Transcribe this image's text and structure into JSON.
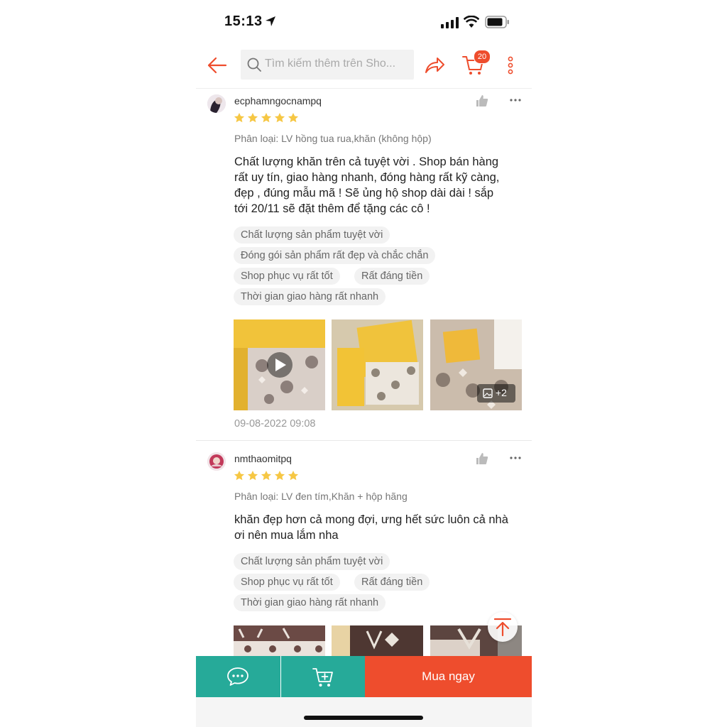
{
  "status": {
    "time": "15:13"
  },
  "header": {
    "search_placeholder": "Tìm kiếm thêm trên Sho...",
    "cart_count": "20"
  },
  "reviews": [
    {
      "username": "ecphamngocnampq",
      "rating": 5,
      "variant": "Phân loại: LV hồng tua rua,khăn (không hộp)",
      "comment_lines": [
        "Chất lượng khăn trên cả tuyệt vời . Shop bán hàng",
        "rất uy tín, giao hàng nhanh, đóng hàng rất kỹ càng,",
        "đẹp , đúng mẫu mã ! Sẽ ủng hộ shop dài dài ! sắp",
        "tới 20/11 sẽ đặt thêm để tặng các cô !"
      ],
      "tags": [
        "Chất lượng sản phẩm tuyệt vời",
        "Đóng gói sản phẩm rất đẹp và chắc chắn",
        "Shop phục vụ rất tốt",
        "Rất đáng tiền",
        "Thời gian giao hàng rất nhanh"
      ],
      "more_photos": "+2",
      "date": "09-08-2022 09:08"
    },
    {
      "username": "nmthaomitpq",
      "rating": 5,
      "variant": "Phân loại: LV đen tím,Khăn + hộp hãng",
      "comment_lines": [
        "khăn đẹp hơn cả mong đợi, ưng hết sức luôn cả nhà",
        "ơi nên mua lắm nha"
      ],
      "tags": [
        "Chất lượng sản phẩm tuyệt vời",
        "Shop phục vụ rất tốt",
        "Rất đáng tiền",
        "Thời gian giao hàng rất nhanh"
      ]
    }
  ],
  "bottom": {
    "buy_label": "Mua ngay"
  },
  "colors": {
    "brand": "#ee4d2d",
    "teal": "#26aa99",
    "star": "#f6c744"
  }
}
